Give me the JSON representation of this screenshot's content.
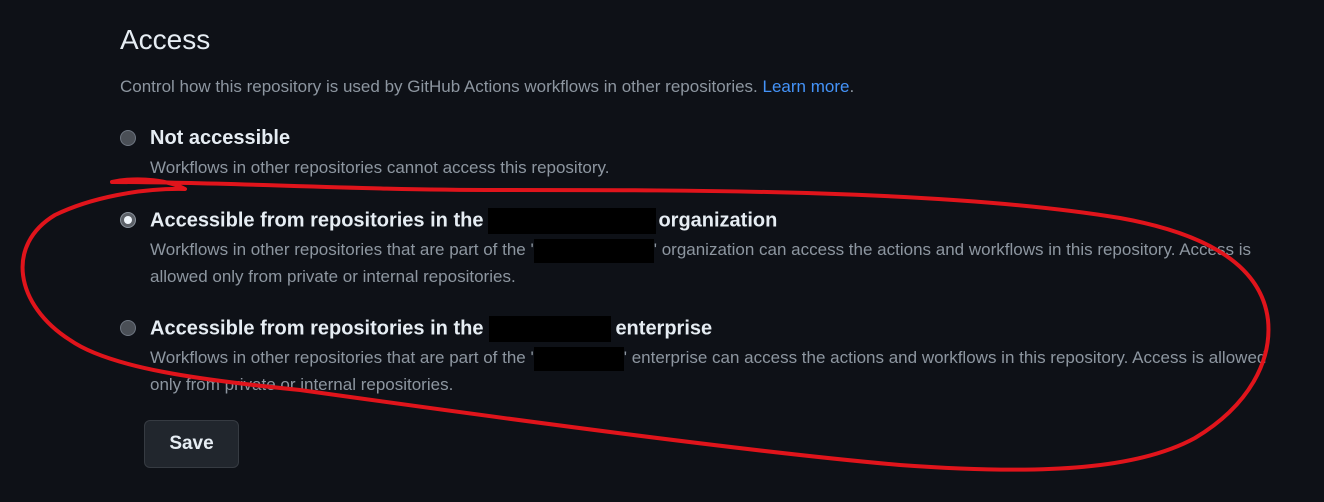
{
  "section": {
    "title": "Access",
    "description": "Control how this repository is used by GitHub Actions workflows in other repositories.",
    "learn_more": "Learn more",
    "trailing_period": "."
  },
  "options": [
    {
      "label": "Not accessible",
      "checked": false,
      "description": "Workflows in other repositories cannot access this repository."
    },
    {
      "label_prefix": "Accessible from repositories in the",
      "label_suffix": "organization",
      "checked": true,
      "desc_prefix": "Workflows in other repositories that are part of the '",
      "desc_suffix": "' organization can access the actions and workflows in this repository. Access is allowed only from private or internal repositories."
    },
    {
      "label_prefix": "Accessible from repositories in the",
      "label_suffix": "enterprise",
      "checked": false,
      "desc_prefix": "Workflows in other repositories that are part of the '",
      "desc_suffix": "' enterprise can access the actions and workflows in this repository. Access is allowed only from private or internal repositories."
    }
  ],
  "save_button": "Save",
  "colors": {
    "background": "#0e1117",
    "link": "#4493f8",
    "muted_text": "#8d96a0",
    "annotation": "#e0141b",
    "redaction": "#000000"
  }
}
